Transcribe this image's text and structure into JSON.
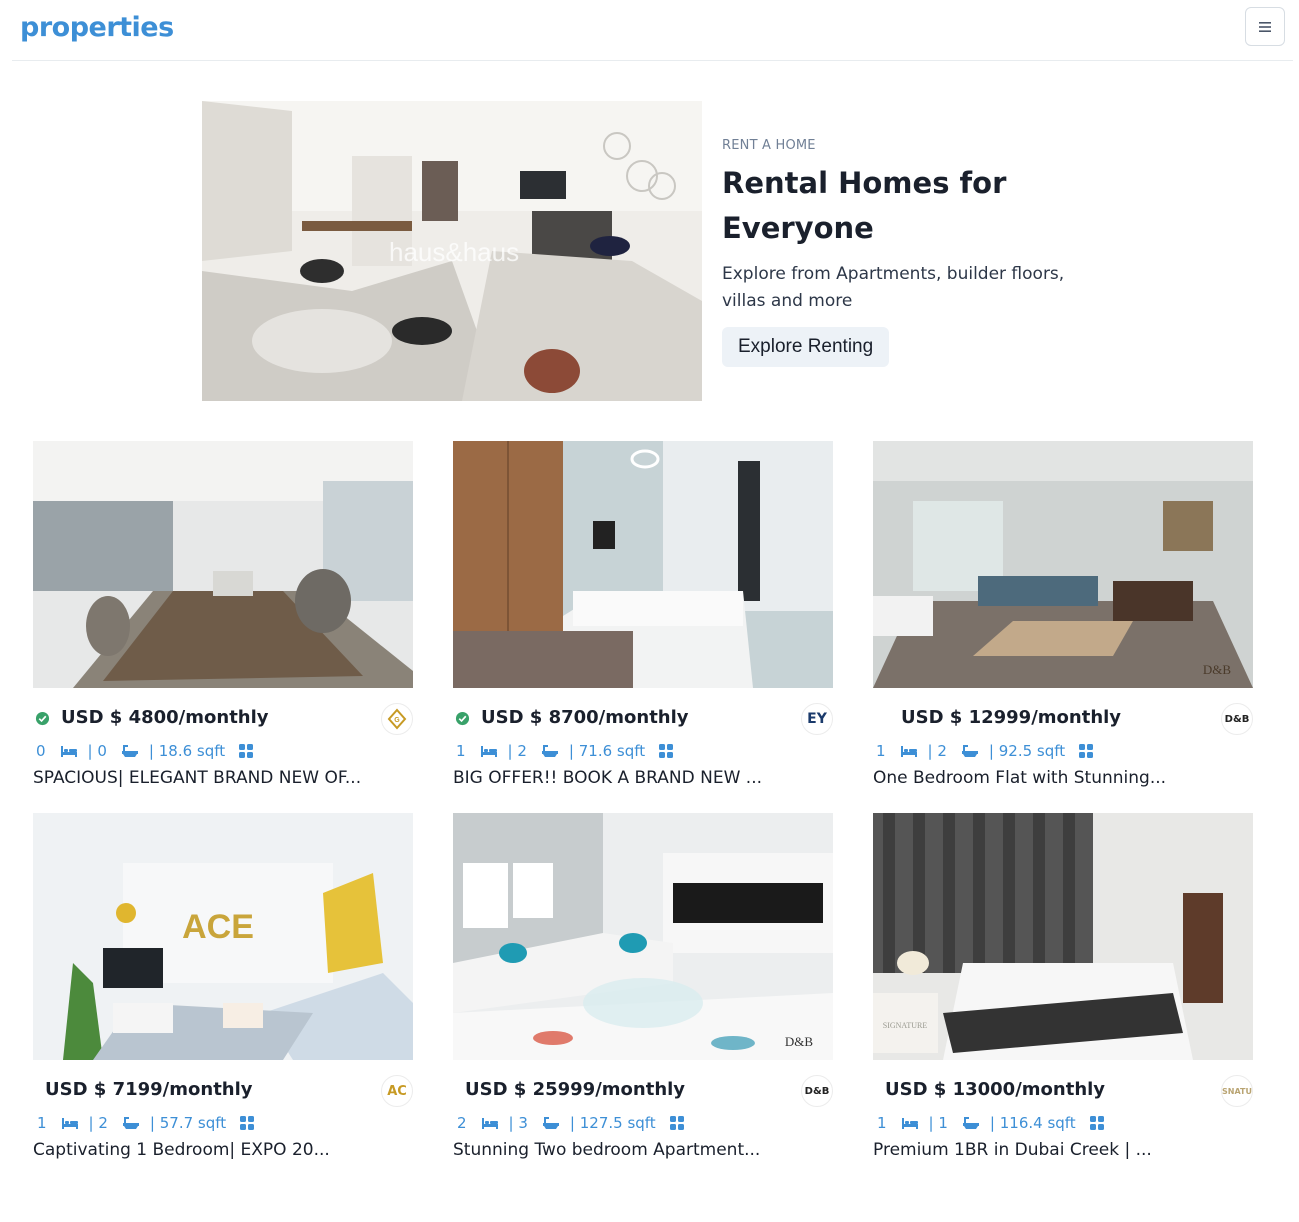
{
  "navbar": {
    "brand": "properties",
    "menu_icon": "hamburger-icon"
  },
  "hero": {
    "kicker": "RENT A HOME",
    "title": "Rental Homes for Everyone",
    "description": "Explore from Apartments, builder floors, villas and more",
    "button_label": "Explore Renting",
    "watermark": "haus&haus"
  },
  "listings": [
    {
      "verified": true,
      "price": "USD $ 4800/monthly",
      "rooms": "0",
      "baths": "| 0",
      "area": "| 18.6 sqft",
      "title": "SPACIOUS| ELEGANT BRAND NEW OF...",
      "agency_logo": "gold-crest-logo"
    },
    {
      "verified": true,
      "price": "USD $ 8700/monthly",
      "rooms": "1",
      "baths": "| 2",
      "area": "| 71.6 sqft",
      "title": "BIG OFFER!! BOOK A BRAND NEW ...",
      "agency_logo": "key-logo"
    },
    {
      "verified": false,
      "price": "USD $ 12999/monthly",
      "rooms": "1",
      "baths": "| 2",
      "area": "| 92.5 sqft",
      "title": "One Bedroom Flat with Stunning...",
      "agency_logo": "dnb-logo"
    },
    {
      "verified": false,
      "price": "USD $ 7199/monthly",
      "rooms": "1",
      "baths": "| 2",
      "area": "| 57.7 sqft",
      "title": "Captivating 1 Bedroom| EXPO 20...",
      "agency_logo": "ace-logo"
    },
    {
      "verified": false,
      "price": "USD $ 25999/monthly",
      "rooms": "2",
      "baths": "| 3",
      "area": "| 127.5 sqft",
      "title": "Stunning Two bedroom Apartment...",
      "agency_logo": "dnb-logo"
    },
    {
      "verified": false,
      "price": "USD $ 13000/monthly",
      "rooms": "1",
      "baths": "| 1",
      "area": "| 116.4 sqft",
      "title": "Premium 1BR in Dubai Creek | ...",
      "agency_logo": "signature-logo"
    }
  ],
  "colors": {
    "accent": "#3d8fd6",
    "verified": "#38a169",
    "button_bg": "#edf2f7"
  }
}
